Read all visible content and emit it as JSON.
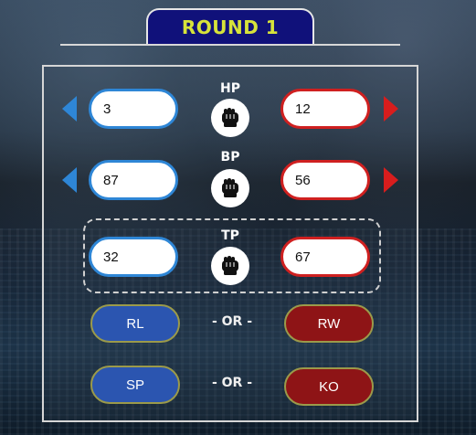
{
  "round": {
    "title": "ROUND 1"
  },
  "stats": [
    {
      "label": "HP",
      "left_value": "3",
      "right_value": "12"
    },
    {
      "label": "BP",
      "left_value": "87",
      "right_value": "56"
    },
    {
      "label": "TP",
      "left_value": "32",
      "right_value": "67"
    }
  ],
  "actions": {
    "rl": "RL",
    "rw": "RW",
    "sp": "SP",
    "ko": "KO",
    "or_1": "- OR -",
    "or_2": "- OR -"
  },
  "colors": {
    "blue_corner": "#2e86d6",
    "red_corner": "#cf2020",
    "title_text": "#d7e33a",
    "tab_background": "#10117a"
  },
  "icons": {
    "stat_icon": "boxing-glove-icon",
    "left_arrow": "left-arrow-icon",
    "right_arrow": "right-arrow-icon"
  }
}
